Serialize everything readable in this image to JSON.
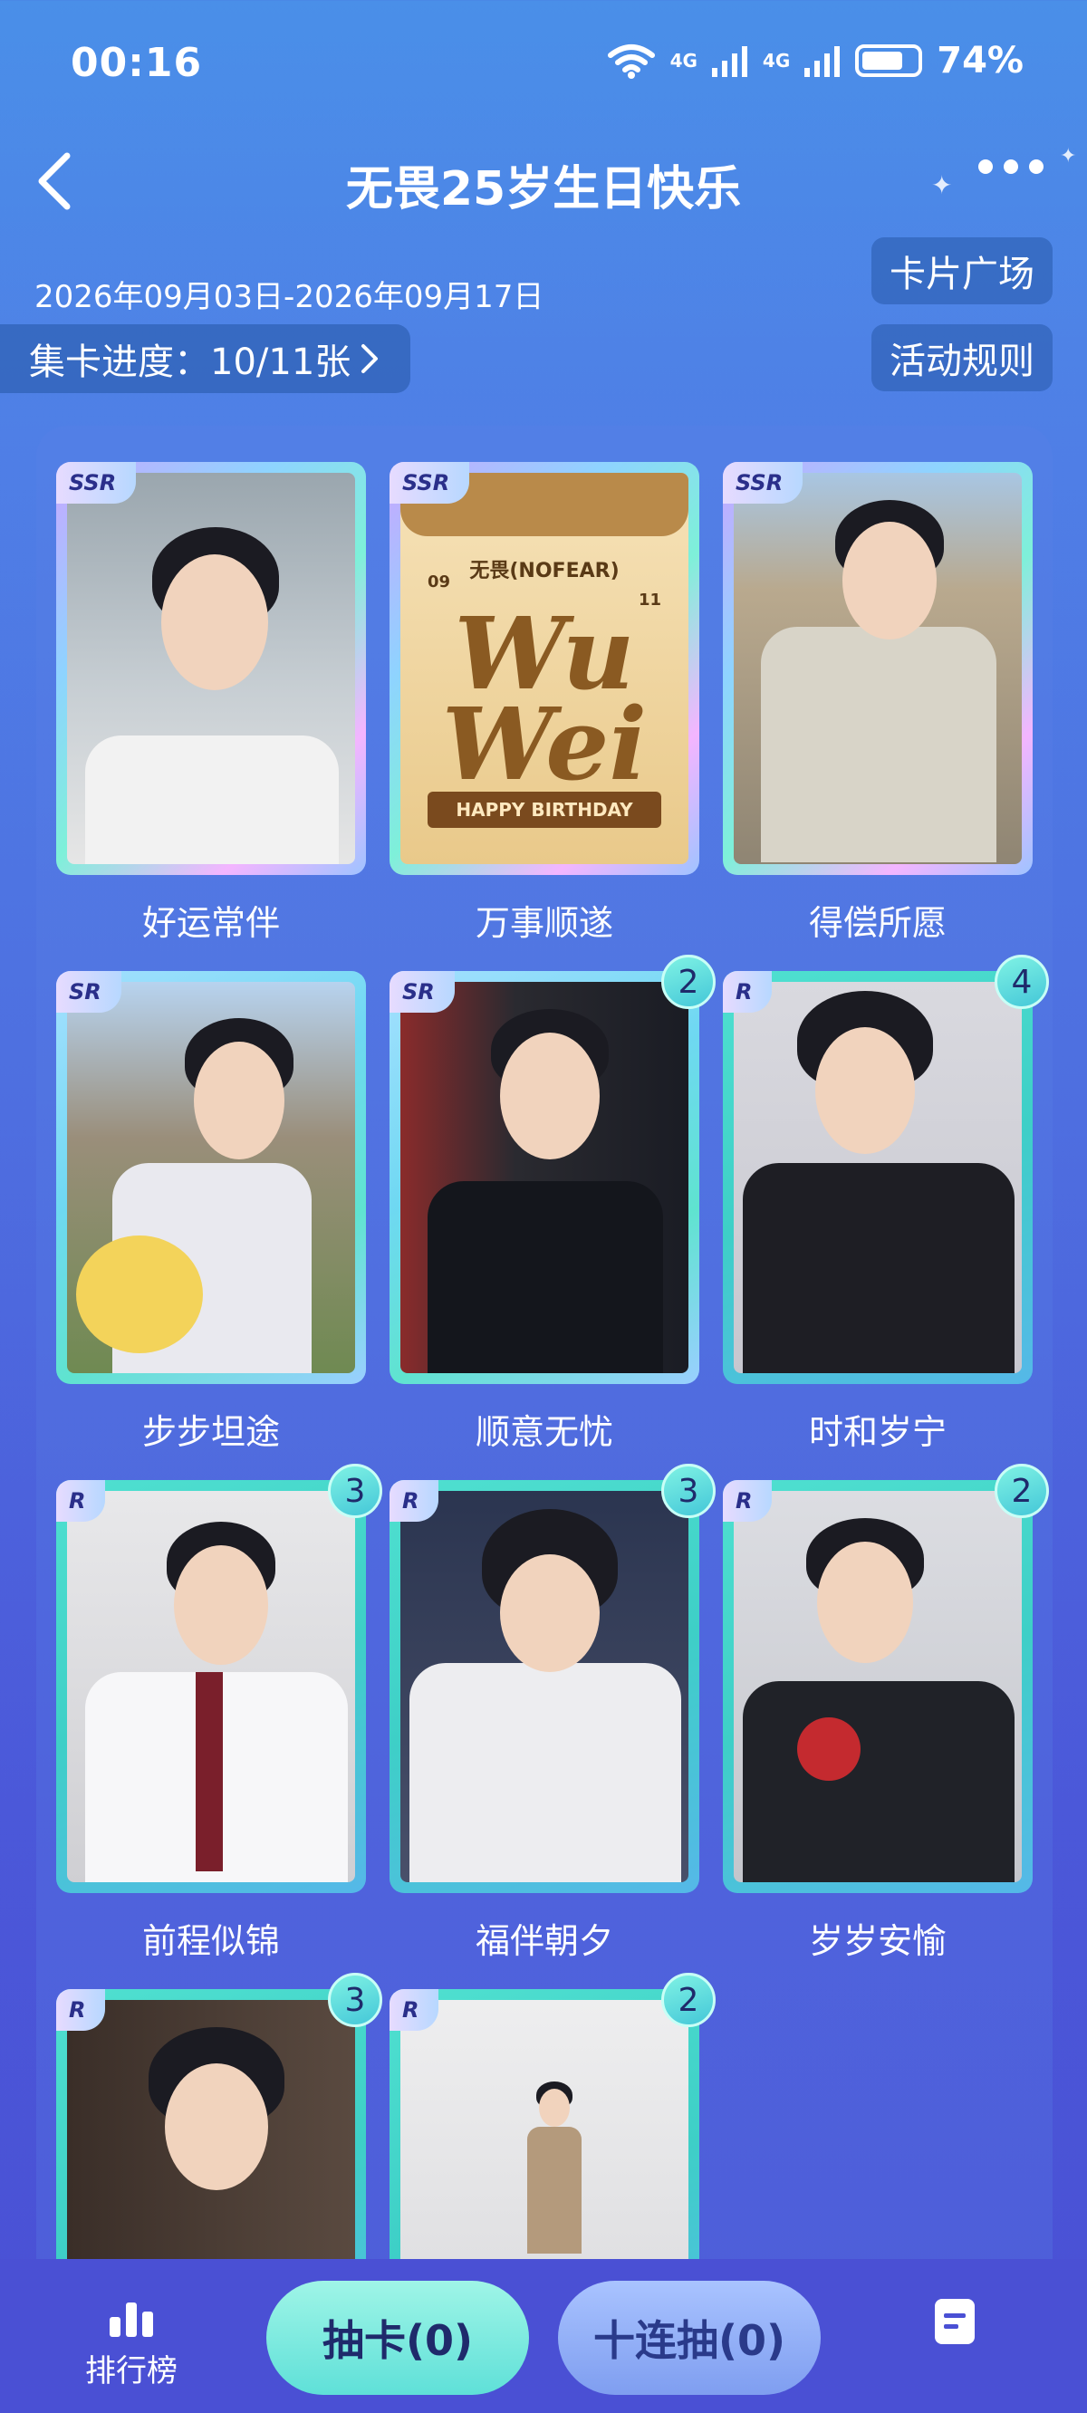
{
  "status_bar": {
    "time": "00:16",
    "net1": "4G",
    "net2": "4G",
    "battery": "74%"
  },
  "header": {
    "title": "无畏25岁生日快乐"
  },
  "event": {
    "date_range": "2026年09月03日-2026年09月17日",
    "progress_label": "集卡进度：10/11张",
    "plaza_button": "卡片广场",
    "rules_button": "活动规则"
  },
  "poster": {
    "brand": "无畏(NOFEAR)",
    "big_text": "Wu Wei",
    "ribbon": "HAPPY BIRTHDAY",
    "num_left": "09",
    "num_right": "11"
  },
  "cards": [
    {
      "rarity": "SSR",
      "label": "好运常伴",
      "count": null
    },
    {
      "rarity": "SSR",
      "label": "万事顺遂",
      "count": null
    },
    {
      "rarity": "SSR",
      "label": "得偿所愿",
      "count": null
    },
    {
      "rarity": "SR",
      "label": "步步坦途",
      "count": null
    },
    {
      "rarity": "SR",
      "label": "顺意无忧",
      "count": "2"
    },
    {
      "rarity": "R",
      "label": "时和岁宁",
      "count": "4"
    },
    {
      "rarity": "R",
      "label": "前程似锦",
      "count": "3"
    },
    {
      "rarity": "R",
      "label": "福伴朝夕",
      "count": "3"
    },
    {
      "rarity": "R",
      "label": "岁岁安愉",
      "count": "2"
    },
    {
      "rarity": "R",
      "label": "",
      "count": "3"
    },
    {
      "rarity": "R",
      "label": "",
      "count": "2"
    }
  ],
  "bottom_bar": {
    "rank_label": "排行榜",
    "draw_label": "抽卡(0)",
    "draw10_label": "十连抽(0)"
  }
}
